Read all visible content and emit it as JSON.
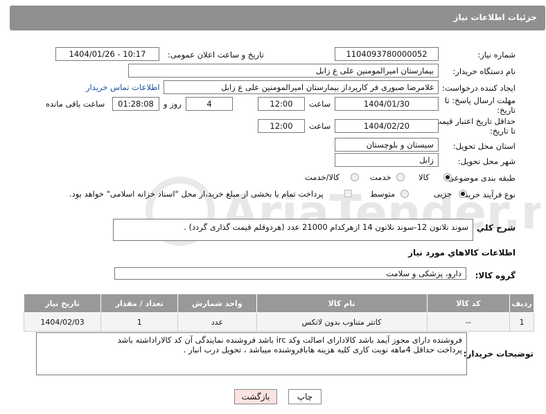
{
  "header": {
    "title": "جزئیات اطلاعات نیاز"
  },
  "fields": {
    "need_number_label": "شماره نیاز:",
    "need_number": "1104093780000052",
    "announce_label": "تاریخ و ساعت اعلان عمومی:",
    "announce_value": "1404/01/26 - 10:17",
    "buyer_org_label": "نام دستگاه خریدار:",
    "buyer_org": "بیمارستان امیرالمومنین علی  ع  زابل",
    "requester_label": "ایجاد کننده درخواست:",
    "requester": "غلامرضا صبوری فر کارپرداز بیمارستان امیرالمومنین علی  ع  زابل",
    "contact_link": "اطلاعات تماس خریدار",
    "deadline_label_1": "مهلت ارسال پاسخ: تا",
    "deadline_label_2": "تاریخ:",
    "deadline_date": "1404/01/30",
    "time_label": "ساعت",
    "deadline_time": "12:00",
    "days_value": "4",
    "days_label": "روز و",
    "remaining_time": "01:28:08",
    "remaining_label": "ساعت باقی مانده",
    "validity_label_1": "حداقل تاریخ اعتبار قیمت:",
    "validity_label_2": "تا تاریخ:",
    "validity_date": "1404/02/20",
    "validity_time": "12:00",
    "province_label": "استان محل تحویل:",
    "province": "سیستان و بلوچستان",
    "city_label": "شهر محل تحویل:",
    "city": "زابل",
    "category_label": "طبقه بندی موضوعی:",
    "category_options": [
      "کالا",
      "خدمت",
      "کالا/خدمت"
    ],
    "process_label": "نوع فرآیند خرید :",
    "process_options": [
      "جزیی",
      "متوسط"
    ],
    "payment_note": "پرداخت تمام یا بخشی از مبلغ خرید،از محل \"اسناد خزانه اسلامی\" خواهد بود.",
    "description_label": "شرح کلي نياز:",
    "description": "سوند نلاتون 12-سوند نلاتون 14  ازهرکدام 21000 عدد (هردوقلم قیمت گذاری گردد) .",
    "goods_info_title": "اطلاعات کالاهاي مورد نياز",
    "goods_group_label": "گروه کالا:",
    "goods_group": "دارو، پزشکی و سلامت"
  },
  "table": {
    "headers": [
      "ردیف",
      "کد کالا",
      "نام کالا",
      "واحد شمارش",
      "تعداد / مقدار",
      "تاریخ نیاز"
    ],
    "rows": [
      [
        "1",
        "--",
        "کاتتر متناوب بدون لاتکس",
        "عدد",
        "1",
        "1404/02/03"
      ]
    ]
  },
  "buyer_notes_label": "توضیحات خریدار:",
  "buyer_notes": [
    "فروشنده دارای مجوز آیمد باشد کالادارای اصالت وکد irc  باشد فروشنده نمایندگی آن کد کالاراداشته باشد",
    "پرداخت حداقل 4ماهه نوبت کاری کلیه هزینه هابافروشنده میباشد ، تحویل درب انبار ."
  ],
  "buttons": {
    "print": "چاپ",
    "back": "بازگشت"
  },
  "watermark_text": "AriaTender.neT",
  "colors": {
    "header_bg": "#909090",
    "link": "#1a4fa0",
    "back_btn_bg": "#fbe3e3"
  }
}
